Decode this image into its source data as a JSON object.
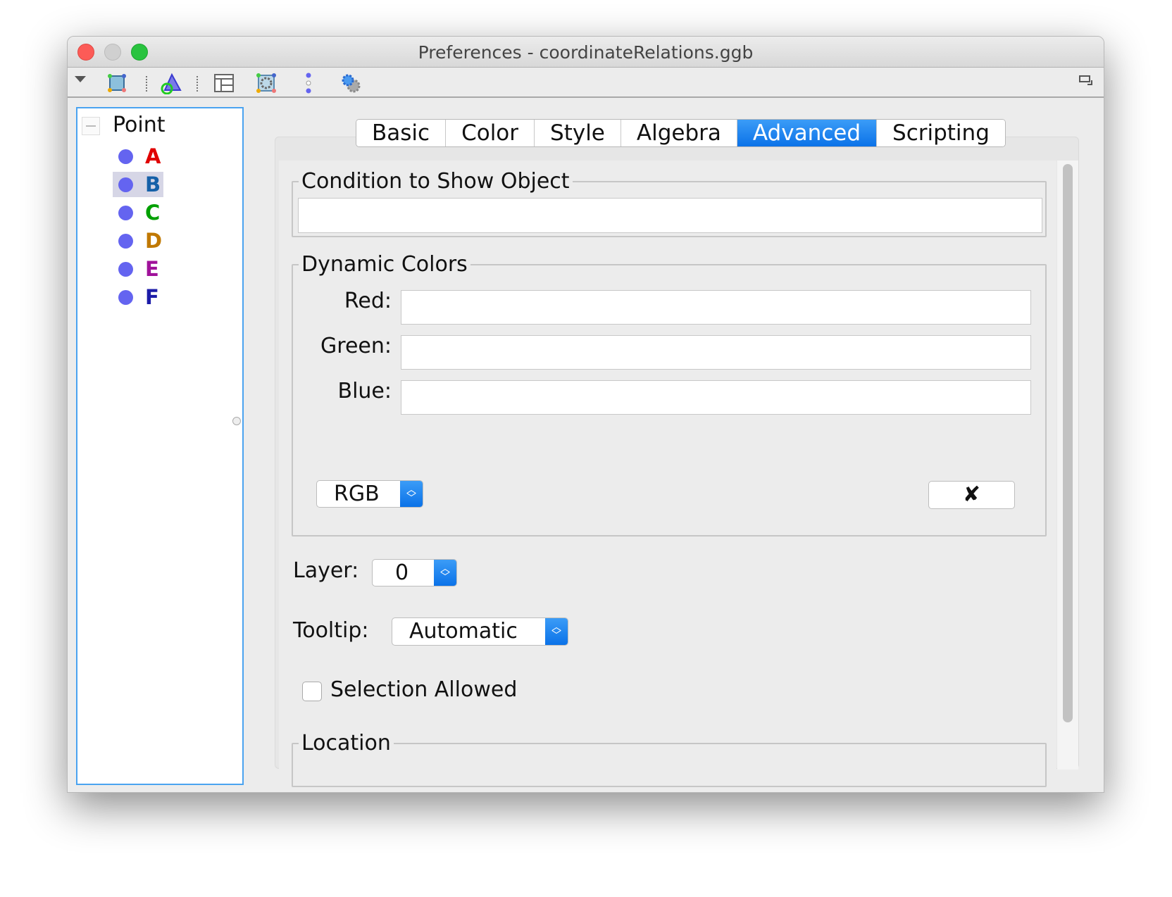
{
  "window": {
    "title": "Preferences - coordinateRelations.ggb"
  },
  "toolbar": {
    "icons": [
      "dropdown-triangle-icon",
      "polygon-icon",
      "geometry-objects-icon",
      "layout-panel-icon",
      "graphics-view-icon",
      "points-icon",
      "settings-gears-icon",
      "undock-icon"
    ]
  },
  "tree": {
    "group": "Point",
    "items": [
      {
        "label": "A",
        "color": "#e00000"
      },
      {
        "label": "B",
        "color": "#1560a8",
        "selected": true
      },
      {
        "label": "C",
        "color": "#00a000"
      },
      {
        "label": "D",
        "color": "#c07800"
      },
      {
        "label": "E",
        "color": "#a0129a"
      },
      {
        "label": "F",
        "color": "#1c1ca8"
      }
    ]
  },
  "tabs": [
    "Basic",
    "Color",
    "Style",
    "Algebra",
    "Advanced",
    "Scripting"
  ],
  "active_tab": "Advanced",
  "advanced": {
    "condition": {
      "legend": "Condition to Show Object",
      "value": ""
    },
    "dynamic_colors": {
      "legend": "Dynamic Colors",
      "red_label": "Red:",
      "green_label": "Green:",
      "blue_label": "Blue:",
      "red": "",
      "green": "",
      "blue": "",
      "mode": "RGB",
      "clear_label": "✘"
    },
    "layer": {
      "label": "Layer:",
      "value": "0"
    },
    "tooltip": {
      "label": "Tooltip:",
      "value": "Automatic"
    },
    "selection_allowed": {
      "label": "Selection Allowed",
      "checked": false
    },
    "location": {
      "legend": "Location"
    }
  }
}
